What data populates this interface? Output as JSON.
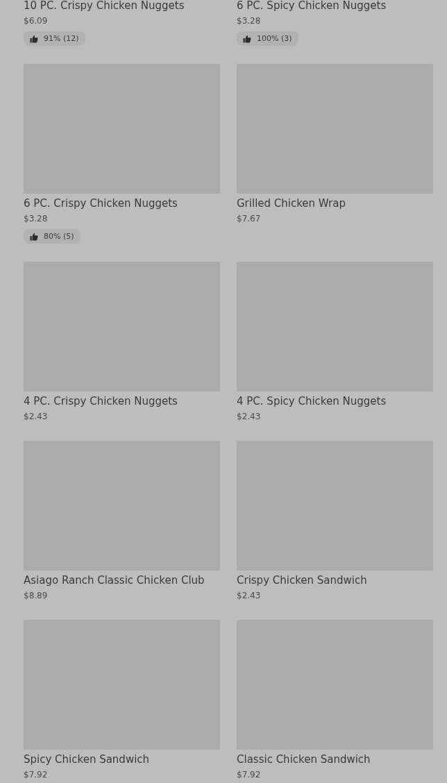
{
  "items": [
    {
      "name": "10 PC. Crispy Chicken Nuggets",
      "price": "$6.09",
      "rating": "91% (12)"
    },
    {
      "name": "6 PC. Spicy Chicken Nuggets",
      "price": "$3.28",
      "rating": "100% (3)"
    },
    {
      "name": "6 PC. Crispy Chicken Nuggets",
      "price": "$3.28",
      "rating": "80% (5)"
    },
    {
      "name": "Grilled Chicken Wrap",
      "price": "$7.67"
    },
    {
      "name": "4 PC. Crispy Chicken Nuggets",
      "price": "$2.43"
    },
    {
      "name": "4 PC. Spicy Chicken Nuggets",
      "price": "$2.43"
    },
    {
      "name": "Asiago Ranch Classic Chicken Club",
      "price": "$8.89"
    },
    {
      "name": "Crispy Chicken Sandwich",
      "price": "$2.43"
    },
    {
      "name": "Spicy Chicken Sandwich",
      "price": "$7.92"
    },
    {
      "name": "Classic Chicken Sandwich",
      "price": "$7.92"
    }
  ]
}
